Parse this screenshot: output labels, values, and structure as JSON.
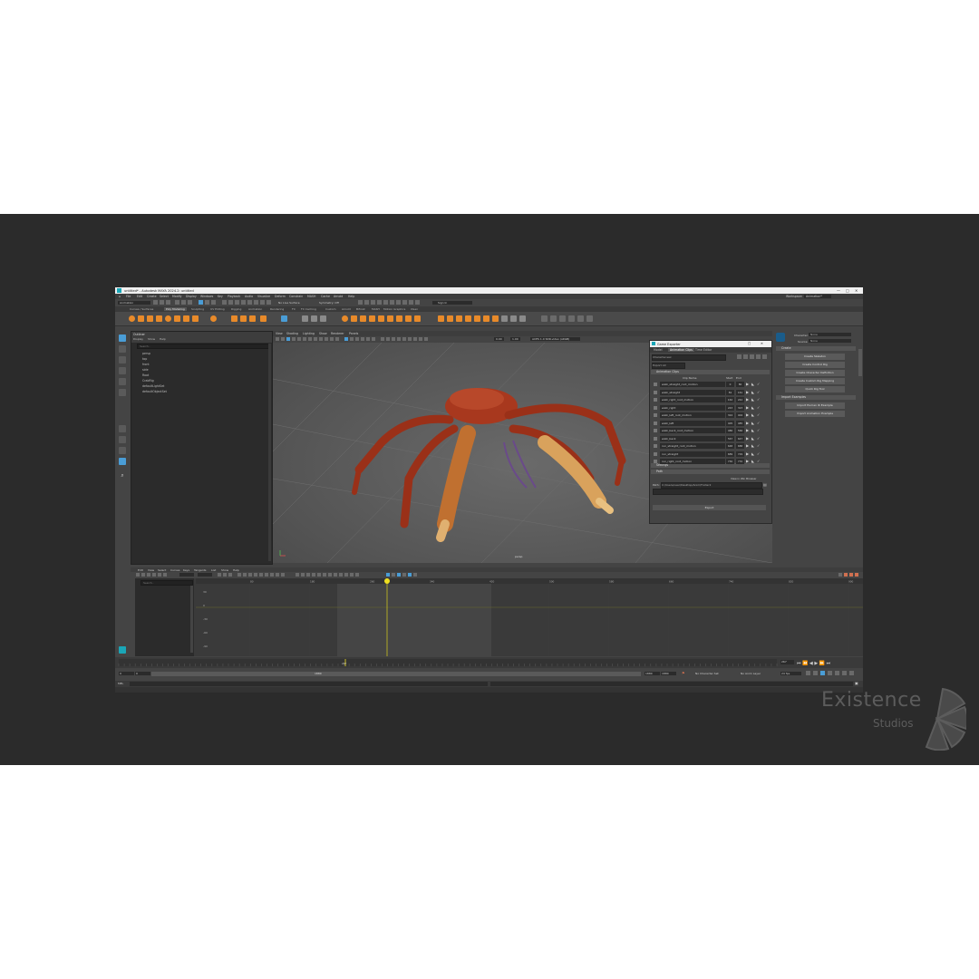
{
  "window": {
    "title": "untitled* - Autodesk MAYA 2024.2: untitled",
    "controls": [
      "—",
      "□",
      "✕"
    ]
  },
  "menubar": {
    "items": [
      "File",
      "Edit",
      "Create",
      "Select",
      "Modify",
      "Display",
      "Windows",
      "Key",
      "Playback",
      "Audio",
      "Visualize",
      "Deform",
      "Constrain",
      "MASH",
      "Cache",
      "Arnold",
      "Help"
    ],
    "workspace_label": "Workspace:",
    "workspace_value": "Animation*"
  },
  "statusline": {
    "mode": "Animation",
    "no_live_surface": "No Live Surface",
    "symmetry": "Symmetry: Off",
    "sign_in": "Sign In"
  },
  "shelf_tabs": [
    "Curves / Surfaces",
    "Poly Modeling",
    "Sculpting",
    "UV Editing",
    "Rigging",
    "Animation",
    "Rendering",
    "FX",
    "FX Caching",
    "Custom",
    "Arnold",
    "Bifrost",
    "MASH",
    "Motion Graphics",
    "XGen"
  ],
  "outliner": {
    "title": "Outliner",
    "menu": [
      "Display",
      "Show",
      "Help"
    ],
    "search_placeholder": "Search...",
    "items": [
      "persp",
      "top",
      "front",
      "side",
      "Root",
      "CrabRig",
      "defaultLightSet",
      "defaultObjectSet"
    ]
  },
  "viewport": {
    "menu": [
      "View",
      "Shading",
      "Lighting",
      "Show",
      "Renderer",
      "Panels"
    ],
    "camera_label": "persp",
    "colorspace": "ACES 1.0 SDR-video (sRGB)",
    "near": "0.00",
    "far": "1.00"
  },
  "game_exporter": {
    "title": "Game Exporter",
    "tabs": [
      "Model",
      "Animation Clips",
      "Time Editor"
    ],
    "preset": "Character.sax",
    "export_all": "Export All",
    "sections": {
      "clips": "Animation Clips",
      "settings": "Settings",
      "path": "Path"
    },
    "columns": {
      "name": "Clip Name",
      "start": "Start",
      "end": "End"
    },
    "clips": [
      {
        "name": "walk_straight_root_motion",
        "start": "0",
        "end": "80"
      },
      {
        "name": "walk_straight",
        "start": "81",
        "end": "161"
      },
      {
        "name": "walk_right_root_motion",
        "start": "162",
        "end": "242"
      },
      {
        "name": "walk_right",
        "start": "243",
        "end": "323"
      },
      {
        "name": "walk_left_root_motion",
        "start": "324",
        "end": "404"
      },
      {
        "name": "walk_left",
        "start": "405",
        "end": "485"
      },
      {
        "name": "walk_back_root_motion",
        "start": "486",
        "end": "566"
      },
      {
        "name": "walk_back",
        "start": "567",
        "end": "647"
      },
      {
        "name": "run_straight_root_motion",
        "start": "648",
        "end": "688"
      },
      {
        "name": "run_straight",
        "start": "689",
        "end": "729"
      },
      {
        "name": "run_right_root_motion",
        "start": "730",
        "end": "770"
      }
    ],
    "path_label": "Path:",
    "path_value": "C:/Users/user/Desktop/Anim/Folder2",
    "view_in_explorer": "View in Win Browser",
    "export_button": "Export"
  },
  "quick_rig_panel": {
    "character_label": "Character:",
    "character_value": "None",
    "source_label": "Source:",
    "source_value": "None",
    "create_section": "Create",
    "create_buttons": [
      "Create Skeleton",
      "Create Control Rig",
      "Create Character Definition",
      "Create Custom Rig Mapping",
      "Quick Rig Tool"
    ],
    "import_section": "Import Examples",
    "import_buttons": [
      "Import Human IK Example",
      "Import Animation Example"
    ]
  },
  "graph_editor": {
    "menu": [
      "Edit",
      "View",
      "Select",
      "Curves",
      "Keys",
      "Tangents",
      "List",
      "Show",
      "Help"
    ],
    "side_tab": "Graph Editor",
    "search_placeholder": "Search...",
    "y_ticks": [
      "30",
      "0",
      "-30",
      "-60",
      "-90"
    ],
    "x_ticks": [
      "80",
      "180",
      "260",
      "340",
      "420",
      "500",
      "580",
      "660",
      "740",
      "820",
      "900"
    ],
    "current_frame": "267"
  },
  "time_slider": {
    "current_frame": "267",
    "start": "0",
    "range_start": "0",
    "range_mid": "1880",
    "range_end": "1880",
    "end": "1880",
    "no_character_set": "No Character Set",
    "no_anim_layer": "No Anim Layer",
    "fps": "24 fps"
  },
  "helpline": {
    "text": "MEL"
  },
  "watermark": {
    "main": "Existence",
    "sub": "Studios"
  },
  "colors": {
    "accent": "#4a9dd6",
    "shelf_orange": "#e88a2a",
    "timeline_marker": "#f0e020",
    "crab_main": "#a8381e",
    "crab_claw": "#d9a25c"
  }
}
